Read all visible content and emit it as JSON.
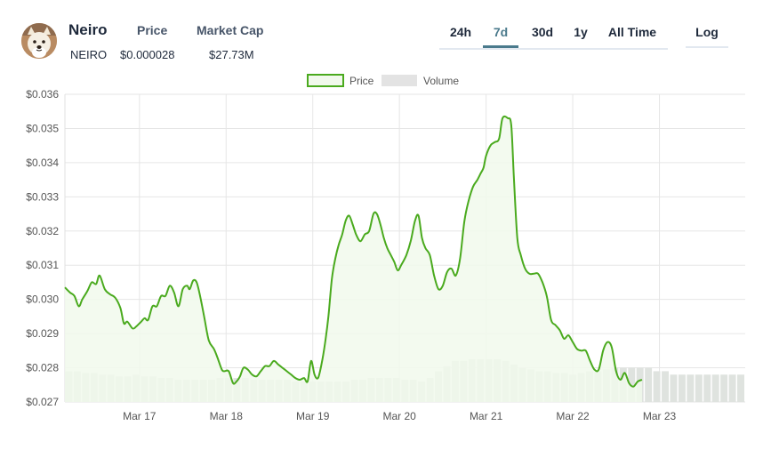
{
  "coin": {
    "name": "Neiro",
    "symbol": "NEIRO",
    "price_label": "Price",
    "price_value": "$0.000028",
    "mcap_label": "Market Cap",
    "mcap_value": "$27.73M"
  },
  "range_tabs": [
    {
      "label": "24h",
      "active": false
    },
    {
      "label": "7d",
      "active": true
    },
    {
      "label": "30d",
      "active": false
    },
    {
      "label": "1y",
      "active": false
    },
    {
      "label": "All Time",
      "active": false
    }
  ],
  "log_label": "Log",
  "colors": {
    "price_line": "#4aaa1e",
    "price_fill": "#f1f9ec",
    "volume": "#dfe3df",
    "active_tab": "#4a7a8c"
  },
  "chart_data": {
    "type": "line",
    "legend": [
      {
        "name": "Price"
      },
      {
        "name": "Volume"
      }
    ],
    "legend_placement": "top-center",
    "grid": true,
    "ylim": [
      0.027,
      0.036
    ],
    "y_ticks": [
      "$0.036",
      "$0.035",
      "$0.034",
      "$0.033",
      "$0.032",
      "$0.031",
      "$0.030",
      "$0.029",
      "$0.028",
      "$0.027"
    ],
    "x_ticks": [
      "Mar 17",
      "Mar 18",
      "Mar 19",
      "Mar 20",
      "Mar 21",
      "Mar 22",
      "Mar 23"
    ],
    "x_tick_days": [
      17,
      18,
      19,
      20,
      21,
      22,
      23
    ],
    "xlim": [
      16.14,
      23.99
    ],
    "price": [
      [
        16.14,
        0.03035
      ],
      [
        16.2,
        0.0302
      ],
      [
        16.25,
        0.0301
      ],
      [
        16.3,
        0.0298
      ],
      [
        16.34,
        0.03
      ],
      [
        16.4,
        0.03025
      ],
      [
        16.45,
        0.0305
      ],
      [
        16.5,
        0.03045
      ],
      [
        16.54,
        0.0307
      ],
      [
        16.6,
        0.0303
      ],
      [
        16.66,
        0.03015
      ],
      [
        16.72,
        0.03005
      ],
      [
        16.78,
        0.02975
      ],
      [
        16.82,
        0.0293
      ],
      [
        16.86,
        0.02935
      ],
      [
        16.92,
        0.02915
      ],
      [
        16.96,
        0.0292
      ],
      [
        17.02,
        0.02935
      ],
      [
        17.06,
        0.02945
      ],
      [
        17.1,
        0.0294
      ],
      [
        17.15,
        0.0298
      ],
      [
        17.2,
        0.0298
      ],
      [
        17.25,
        0.0301
      ],
      [
        17.3,
        0.0301
      ],
      [
        17.35,
        0.0304
      ],
      [
        17.4,
        0.0302
      ],
      [
        17.45,
        0.0298
      ],
      [
        17.5,
        0.0303
      ],
      [
        17.55,
        0.0304
      ],
      [
        17.58,
        0.0303
      ],
      [
        17.62,
        0.03055
      ],
      [
        17.66,
        0.0305
      ],
      [
        17.7,
        0.0301
      ],
      [
        17.75,
        0.02945
      ],
      [
        17.8,
        0.0288
      ],
      [
        17.86,
        0.02855
      ],
      [
        17.9,
        0.0283
      ],
      [
        17.95,
        0.02795
      ],
      [
        17.98,
        0.0279
      ],
      [
        18.03,
        0.0279
      ],
      [
        18.08,
        0.02755
      ],
      [
        18.12,
        0.0276
      ],
      [
        18.16,
        0.02775
      ],
      [
        18.2,
        0.028
      ],
      [
        18.25,
        0.02795
      ],
      [
        18.3,
        0.0278
      ],
      [
        18.35,
        0.02775
      ],
      [
        18.4,
        0.0279
      ],
      [
        18.45,
        0.02805
      ],
      [
        18.5,
        0.02805
      ],
      [
        18.55,
        0.0282
      ],
      [
        18.6,
        0.0281
      ],
      [
        18.65,
        0.028
      ],
      [
        18.7,
        0.0279
      ],
      [
        18.75,
        0.0278
      ],
      [
        18.8,
        0.0277
      ],
      [
        18.85,
        0.02765
      ],
      [
        18.9,
        0.0277
      ],
      [
        18.94,
        0.0276
      ],
      [
        18.98,
        0.0282
      ],
      [
        19.02,
        0.0278
      ],
      [
        19.06,
        0.0277
      ],
      [
        19.1,
        0.0281
      ],
      [
        19.14,
        0.0287
      ],
      [
        19.18,
        0.0295
      ],
      [
        19.22,
        0.0306
      ],
      [
        19.26,
        0.0312
      ],
      [
        19.3,
        0.0316
      ],
      [
        19.34,
        0.0319
      ],
      [
        19.38,
        0.0323
      ],
      [
        19.42,
        0.03245
      ],
      [
        19.46,
        0.0322
      ],
      [
        19.5,
        0.0319
      ],
      [
        19.55,
        0.0317
      ],
      [
        19.6,
        0.0319
      ],
      [
        19.65,
        0.032
      ],
      [
        19.7,
        0.0325
      ],
      [
        19.74,
        0.0325
      ],
      [
        19.78,
        0.0322
      ],
      [
        19.82,
        0.0318
      ],
      [
        19.86,
        0.0315
      ],
      [
        19.9,
        0.0313
      ],
      [
        19.94,
        0.0311
      ],
      [
        19.98,
        0.03085
      ],
      [
        20.02,
        0.031
      ],
      [
        20.08,
        0.0313
      ],
      [
        20.13,
        0.0317
      ],
      [
        20.18,
        0.0323
      ],
      [
        20.22,
        0.03245
      ],
      [
        20.26,
        0.0318
      ],
      [
        20.3,
        0.0315
      ],
      [
        20.35,
        0.0313
      ],
      [
        20.4,
        0.0307
      ],
      [
        20.45,
        0.0303
      ],
      [
        20.5,
        0.0304
      ],
      [
        20.55,
        0.0308
      ],
      [
        20.6,
        0.0309
      ],
      [
        20.65,
        0.0307
      ],
      [
        20.7,
        0.0312
      ],
      [
        20.75,
        0.0323
      ],
      [
        20.8,
        0.0329
      ],
      [
        20.85,
        0.0333
      ],
      [
        20.9,
        0.0335
      ],
      [
        20.94,
        0.0337
      ],
      [
        20.97,
        0.03385
      ],
      [
        21.0,
        0.0342
      ],
      [
        21.05,
        0.0345
      ],
      [
        21.1,
        0.0346
      ],
      [
        21.15,
        0.0347
      ],
      [
        21.19,
        0.0353
      ],
      [
        21.25,
        0.0353
      ],
      [
        21.29,
        0.0351
      ],
      [
        21.32,
        0.0336
      ],
      [
        21.36,
        0.0318
      ],
      [
        21.4,
        0.0313
      ],
      [
        21.45,
        0.0309
      ],
      [
        21.5,
        0.03075
      ],
      [
        21.55,
        0.03075
      ],
      [
        21.6,
        0.03075
      ],
      [
        21.65,
        0.0305
      ],
      [
        21.7,
        0.0301
      ],
      [
        21.75,
        0.0294
      ],
      [
        21.8,
        0.02925
      ],
      [
        21.85,
        0.0291
      ],
      [
        21.9,
        0.02885
      ],
      [
        21.95,
        0.02895
      ],
      [
        22.0,
        0.02875
      ],
      [
        22.05,
        0.02855
      ],
      [
        22.1,
        0.0285
      ],
      [
        22.15,
        0.0285
      ],
      [
        22.2,
        0.0282
      ],
      [
        22.25,
        0.02795
      ],
      [
        22.3,
        0.02795
      ],
      [
        22.35,
        0.0285
      ],
      [
        22.4,
        0.02875
      ],
      [
        22.45,
        0.0286
      ],
      [
        22.5,
        0.0279
      ],
      [
        22.55,
        0.02765
      ],
      [
        22.6,
        0.02785
      ],
      [
        22.65,
        0.02755
      ],
      [
        22.7,
        0.02745
      ],
      [
        22.75,
        0.0276
      ],
      [
        22.8,
        0.02765
      ]
    ],
    "volume": [
      0.0279,
      0.0279,
      0.02785,
      0.02785,
      0.0278,
      0.0278,
      0.02775,
      0.02775,
      0.0278,
      0.02775,
      0.02775,
      0.0277,
      0.0277,
      0.02765,
      0.02765,
      0.02765,
      0.02765,
      0.02765,
      0.0277,
      0.0277,
      0.0277,
      0.0277,
      0.02765,
      0.02765,
      0.02765,
      0.02765,
      0.02765,
      0.0276,
      0.0276,
      0.0276,
      0.0276,
      0.0276,
      0.0276,
      0.0276,
      0.02765,
      0.02765,
      0.0277,
      0.0277,
      0.0277,
      0.0277,
      0.02765,
      0.02765,
      0.0276,
      0.0277,
      0.0279,
      0.02805,
      0.0282,
      0.0282,
      0.02825,
      0.02825,
      0.02825,
      0.02825,
      0.0282,
      0.0281,
      0.028,
      0.02795,
      0.0279,
      0.0279,
      0.02785,
      0.02785,
      0.0278,
      0.02785,
      0.0279,
      0.0279,
      0.02795,
      0.028,
      0.028,
      0.028,
      0.028,
      0.028,
      0.0279,
      0.0279,
      0.0278,
      0.0278,
      0.0278,
      0.0278,
      0.0278,
      0.0278,
      0.0278,
      0.0278,
      0.0278
    ]
  }
}
